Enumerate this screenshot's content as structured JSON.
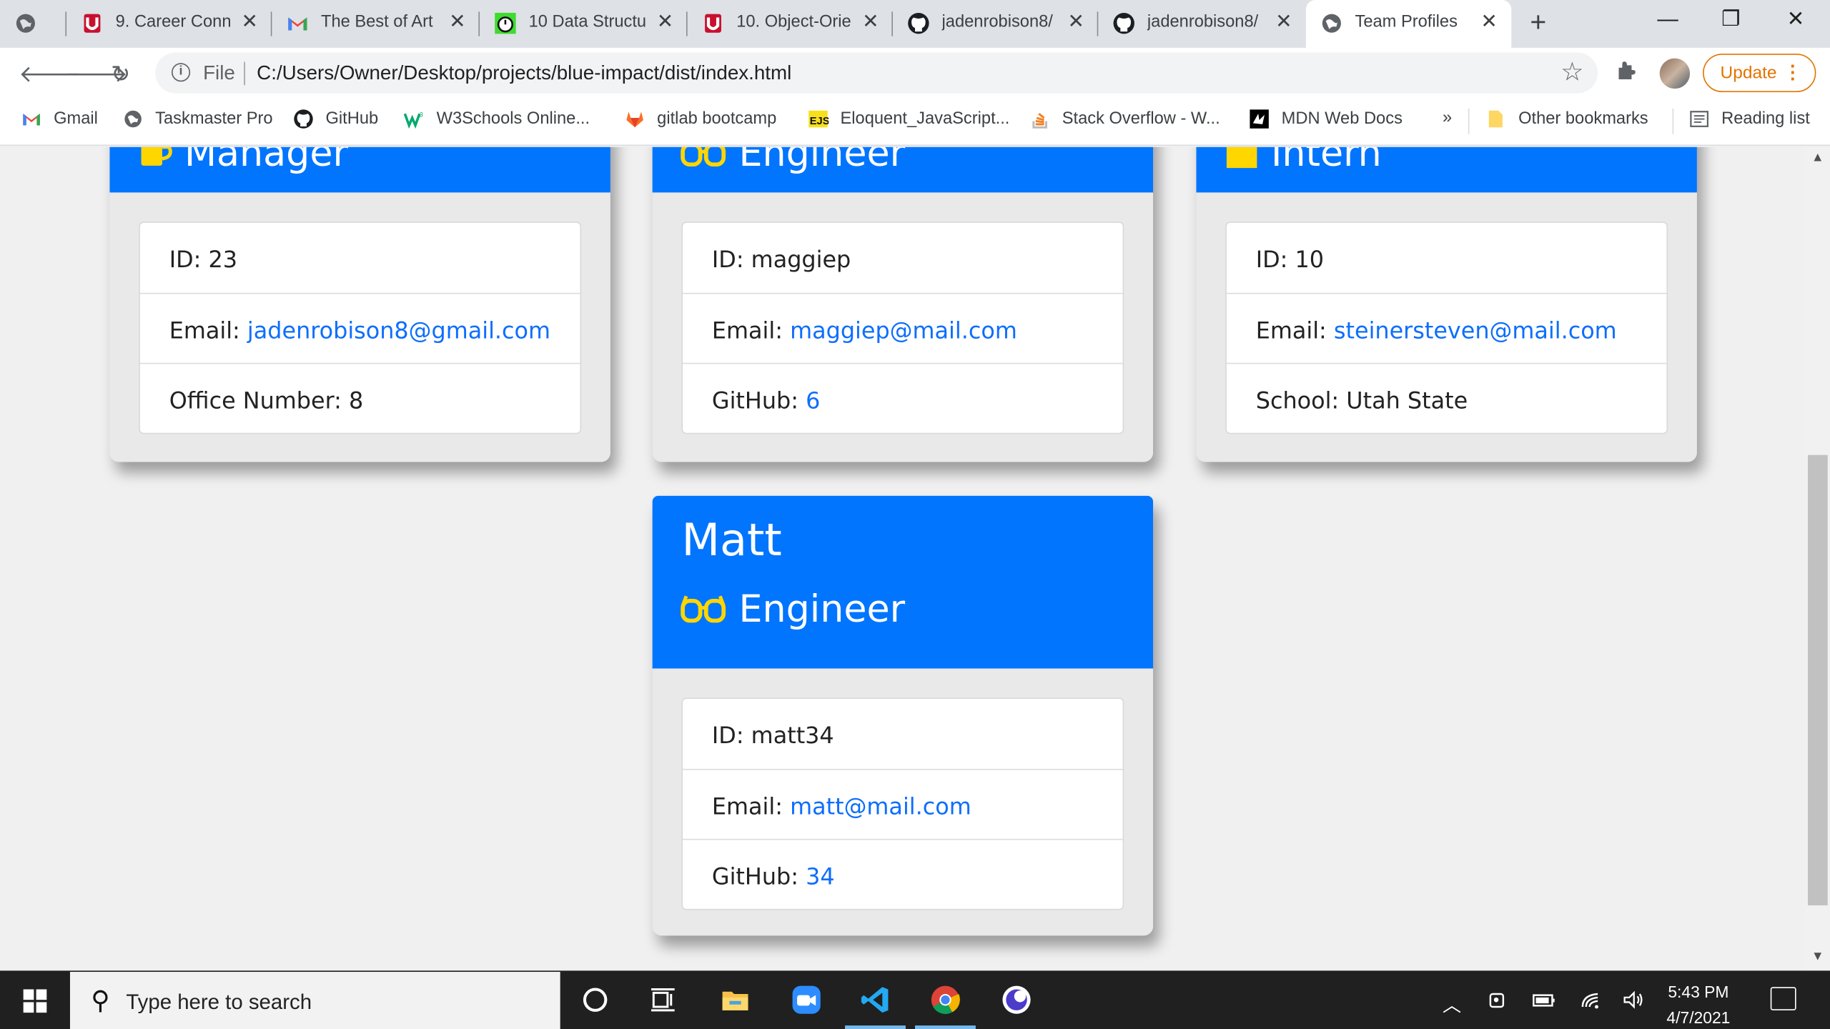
{
  "browser": {
    "tabs": [
      {
        "title": "",
        "icon": "globe-icon"
      },
      {
        "title": "9. Career Conn",
        "icon": "u-logo-icon"
      },
      {
        "title": "The Best of Art",
        "icon": "gmail-icon"
      },
      {
        "title": "10 Data Structu",
        "icon": "stopwatch-icon"
      },
      {
        "title": "10. Object-Orie",
        "icon": "u-logo-icon"
      },
      {
        "title": "jadenrobison8/",
        "icon": "github-icon"
      },
      {
        "title": "jadenrobison8/",
        "icon": "github-icon"
      },
      {
        "title": "Team Profiles",
        "icon": "globe-icon"
      }
    ],
    "close_glyph": "✕",
    "new_tab_glyph": "+",
    "window_controls": {
      "minimize": "—",
      "restore": "❐",
      "close": "✕"
    },
    "address": {
      "scheme_label": "File",
      "url": "C:/Users/Owner/Desktop/projects/blue-impact/dist/index.html"
    },
    "update_label": "Update",
    "bookmarks": [
      {
        "label": "Gmail",
        "icon": "gmail-icon"
      },
      {
        "label": "Taskmaster Pro",
        "icon": "globe-icon"
      },
      {
        "label": "GitHub",
        "icon": "github-icon"
      },
      {
        "label": "W3Schools Online...",
        "icon": "w3schools-icon"
      },
      {
        "label": "gitlab bootcamp",
        "icon": "gitlab-icon"
      },
      {
        "label": "Eloquent_JavaScript...",
        "icon": "ejs-icon"
      },
      {
        "label": "Stack Overflow - W...",
        "icon": "stackoverflow-icon"
      },
      {
        "label": "MDN Web Docs",
        "icon": "mdn-icon"
      }
    ],
    "bookmarks_overflow": "»",
    "other_bookmarks": "Other bookmarks",
    "reading_list": "Reading list"
  },
  "page": {
    "cards": [
      {
        "name": "",
        "role": "Manager",
        "role_icon": "mug-icon",
        "id_label": "ID:",
        "id": "23",
        "email_label": "Email:",
        "email": "jadenrobison8@gmail.com",
        "extra_label": "Office Number:",
        "extra": "8",
        "extra_is_link": false
      },
      {
        "name": "",
        "role": "Engineer",
        "role_icon": "glasses-icon",
        "id_label": "ID:",
        "id": "maggiep",
        "email_label": "Email:",
        "email": "maggiep@mail.com",
        "extra_label": "GitHub:",
        "extra": "6",
        "extra_is_link": true
      },
      {
        "name": "",
        "role": "Intern",
        "role_icon": "graduation-cap-icon",
        "id_label": "ID:",
        "id": "10",
        "email_label": "Email:",
        "email": "steinersteven@mail.com",
        "extra_label": "School:",
        "extra": "Utah State",
        "extra_is_link": false
      },
      {
        "name": "Matt",
        "role": "Engineer",
        "role_icon": "glasses-icon",
        "id_label": "ID:",
        "id": "matt34",
        "email_label": "Email:",
        "email": "matt@mail.com",
        "extra_label": "GitHub:",
        "extra": "34",
        "extra_is_link": true
      }
    ],
    "colors": {
      "header_blue": "#0275fe",
      "link_blue": "#0d6efd",
      "icon_yellow": "#ffd600"
    }
  },
  "taskbar": {
    "search_placeholder": "Type here to search",
    "apps": [
      "cortana-icon",
      "task-view-icon",
      "file-explorer-icon",
      "zoom-icon",
      "vscode-icon",
      "chrome-icon",
      "app-icon"
    ],
    "time": "5:43 PM",
    "date": "4/7/2021"
  }
}
